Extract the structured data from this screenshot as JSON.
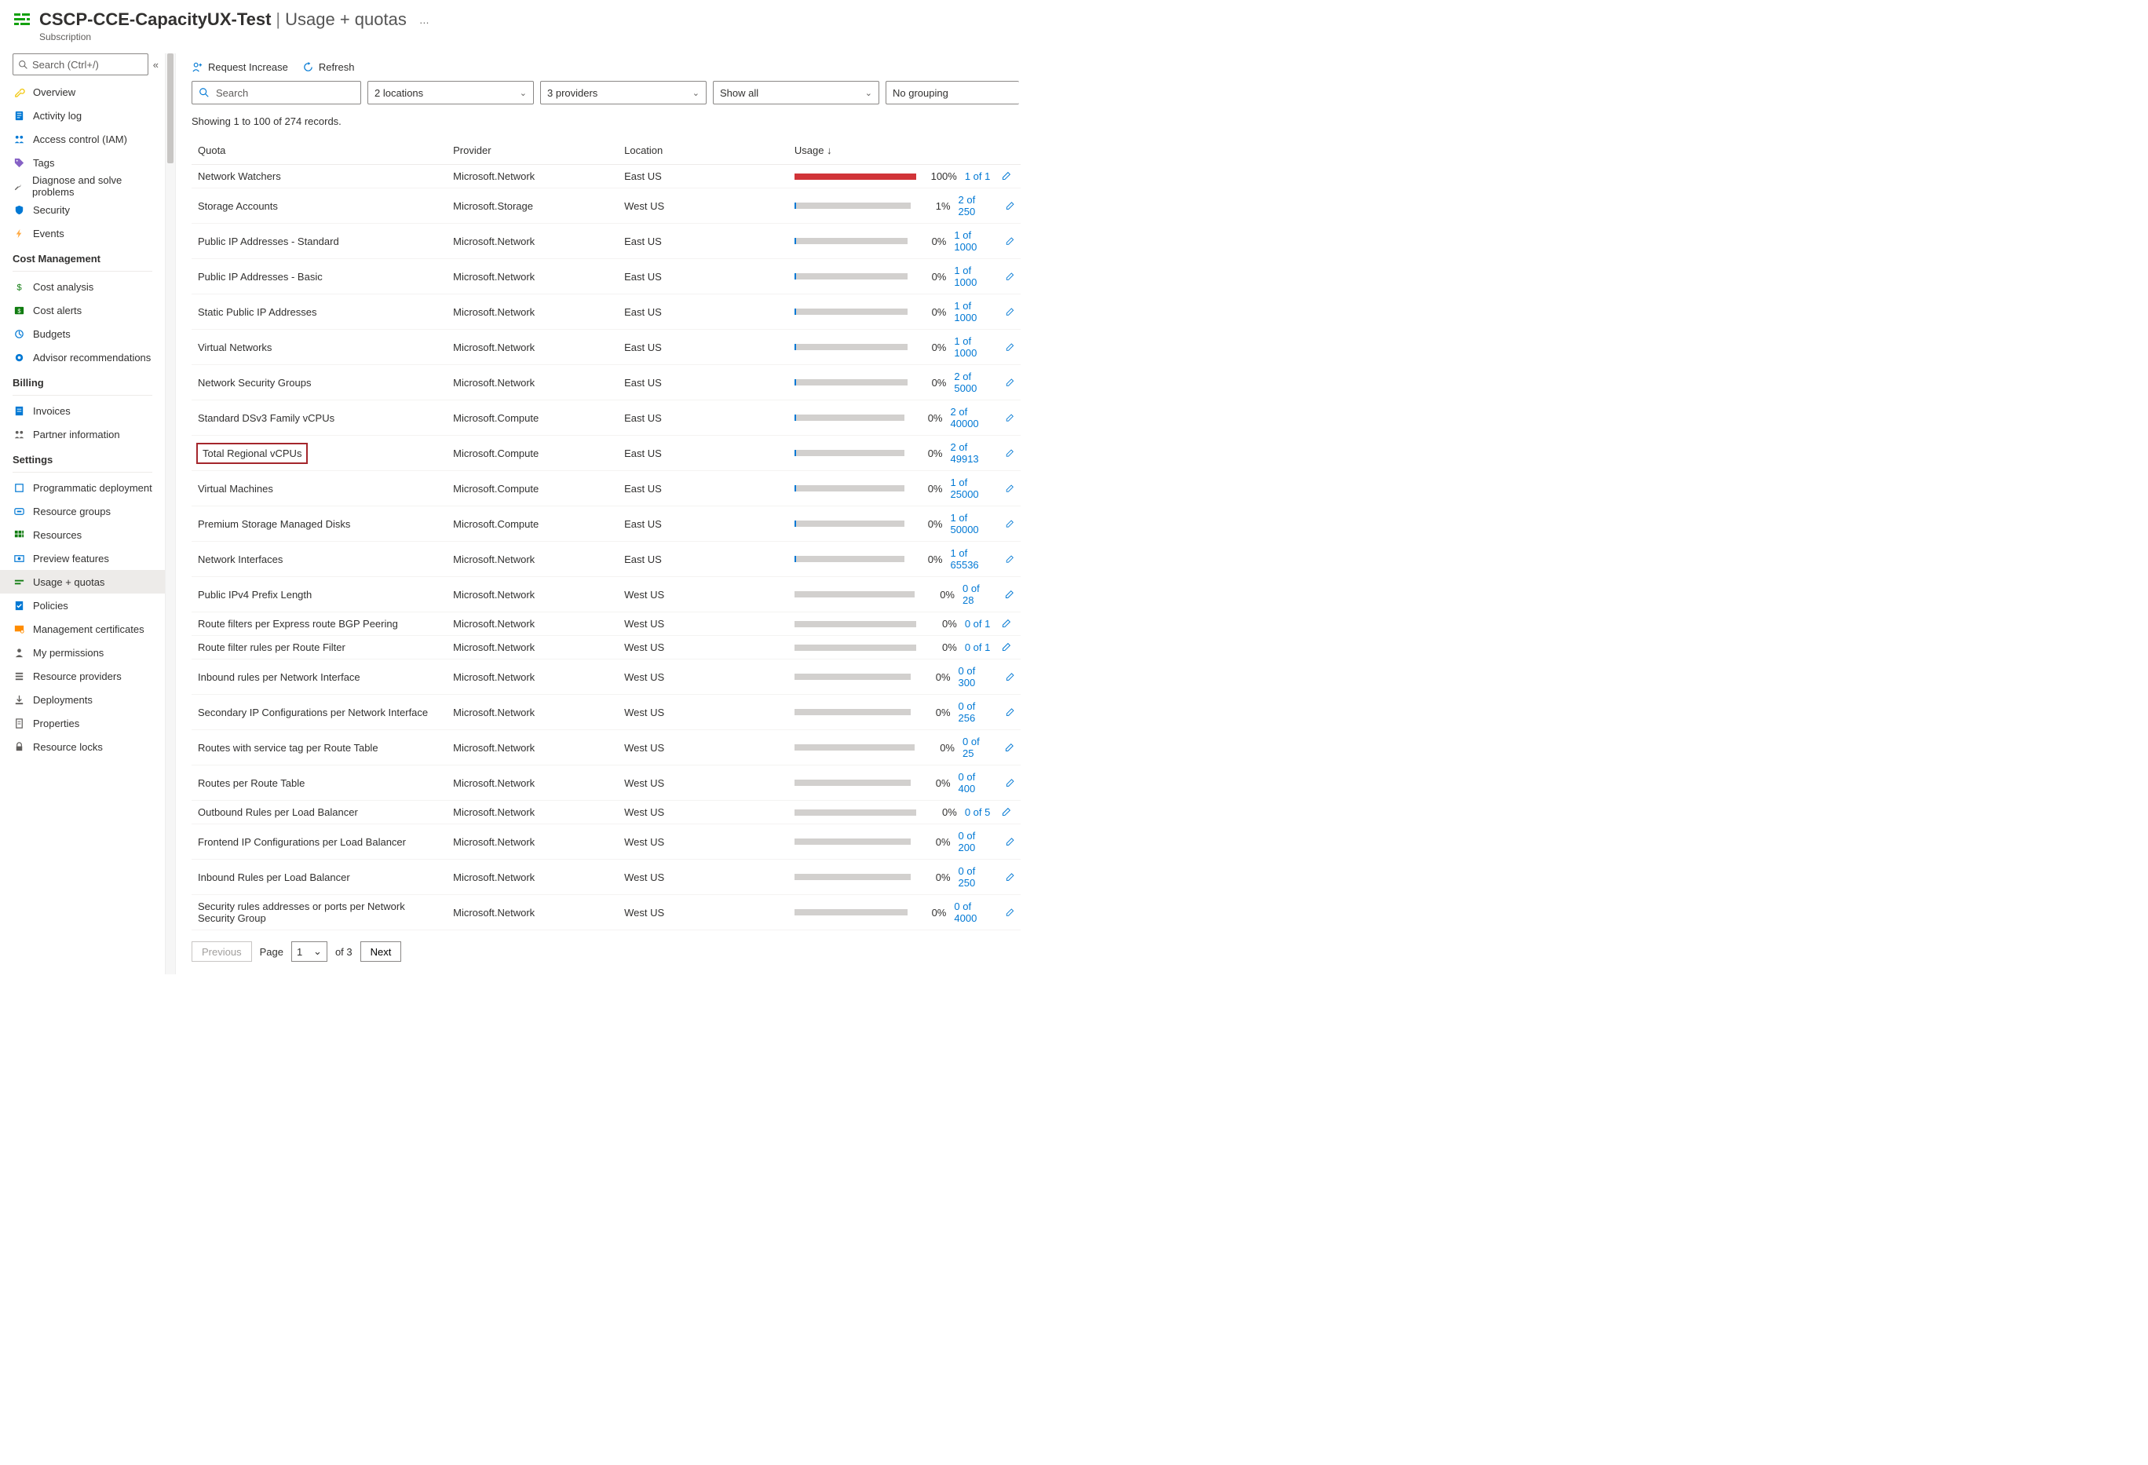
{
  "header": {
    "title": "CSCP-CCE-CapacityUX-Test",
    "page": "Usage + quotas",
    "subtitle": "Subscription",
    "more": "…"
  },
  "sidebar": {
    "search_placeholder": "Search (Ctrl+/)",
    "collapse_glyph": "«",
    "top_items": [
      {
        "label": "Overview",
        "icon": "key",
        "color": "#f2c811"
      },
      {
        "label": "Activity log",
        "icon": "log",
        "color": "#0078d4"
      },
      {
        "label": "Access control (IAM)",
        "icon": "people",
        "color": "#0078d4"
      },
      {
        "label": "Tags",
        "icon": "tag",
        "color": "#8661c5"
      },
      {
        "label": "Diagnose and solve problems",
        "icon": "wrench",
        "color": "#605e5c"
      },
      {
        "label": "Security",
        "icon": "shield",
        "color": "#0078d4"
      },
      {
        "label": "Events",
        "icon": "bolt",
        "color": "#ffaa44"
      }
    ],
    "sections": [
      {
        "title": "Cost Management",
        "items": [
          {
            "label": "Cost analysis",
            "icon": "dollar",
            "color": "#107c10"
          },
          {
            "label": "Cost alerts",
            "icon": "dollarbox",
            "color": "#107c10"
          },
          {
            "label": "Budgets",
            "icon": "budget",
            "color": "#0078d4"
          },
          {
            "label": "Advisor recommendations",
            "icon": "advisor",
            "color": "#0078d4"
          }
        ]
      },
      {
        "title": "Billing",
        "items": [
          {
            "label": "Invoices",
            "icon": "invoice",
            "color": "#0078d4"
          },
          {
            "label": "Partner information",
            "icon": "people",
            "color": "#605e5c"
          }
        ]
      },
      {
        "title": "Settings",
        "items": [
          {
            "label": "Programmatic deployment",
            "icon": "box",
            "color": "#0078d4"
          },
          {
            "label": "Resource groups",
            "icon": "rg",
            "color": "#0078d4"
          },
          {
            "label": "Resources",
            "icon": "grid",
            "color": "#107c10"
          },
          {
            "label": "Preview features",
            "icon": "preview",
            "color": "#0078d4"
          },
          {
            "label": "Usage + quotas",
            "icon": "quota",
            "color": "#107c10",
            "selected": true
          },
          {
            "label": "Policies",
            "icon": "policy",
            "color": "#0078d4"
          },
          {
            "label": "Management certificates",
            "icon": "cert",
            "color": "#ff8c00"
          },
          {
            "label": "My permissions",
            "icon": "person",
            "color": "#605e5c"
          },
          {
            "label": "Resource providers",
            "icon": "stack",
            "color": "#605e5c"
          },
          {
            "label": "Deployments",
            "icon": "deploy",
            "color": "#605e5c"
          },
          {
            "label": "Properties",
            "icon": "props",
            "color": "#605e5c"
          },
          {
            "label": "Resource locks",
            "icon": "lock",
            "color": "#605e5c"
          }
        ]
      }
    ]
  },
  "toolbar": {
    "request_increase": "Request Increase",
    "refresh": "Refresh"
  },
  "filters": {
    "search_placeholder": "Search",
    "locations": "2 locations",
    "providers": "3 providers",
    "usage": "Show all",
    "grouping": "No grouping"
  },
  "result_count": "Showing 1 to 100 of 274 records.",
  "table": {
    "headers": {
      "quota": "Quota",
      "provider": "Provider",
      "location": "Location",
      "usage": "Usage ↓"
    },
    "rows": [
      {
        "quota": "Network Watchers",
        "provider": "Microsoft.Network",
        "location": "East US",
        "pct": "100%",
        "link": "1 of 1",
        "bar": "full"
      },
      {
        "quota": "Storage Accounts",
        "provider": "Microsoft.Storage",
        "location": "West US",
        "pct": "1%",
        "link": "2 of 250",
        "bar": "tick"
      },
      {
        "quota": "Public IP Addresses - Standard",
        "provider": "Microsoft.Network",
        "location": "East US",
        "pct": "0%",
        "link": "1 of 1000",
        "bar": "tick"
      },
      {
        "quota": "Public IP Addresses - Basic",
        "provider": "Microsoft.Network",
        "location": "East US",
        "pct": "0%",
        "link": "1 of 1000",
        "bar": "tick"
      },
      {
        "quota": "Static Public IP Addresses",
        "provider": "Microsoft.Network",
        "location": "East US",
        "pct": "0%",
        "link": "1 of 1000",
        "bar": "tick"
      },
      {
        "quota": "Virtual Networks",
        "provider": "Microsoft.Network",
        "location": "East US",
        "pct": "0%",
        "link": "1 of 1000",
        "bar": "tick"
      },
      {
        "quota": "Network Security Groups",
        "provider": "Microsoft.Network",
        "location": "East US",
        "pct": "0%",
        "link": "2 of 5000",
        "bar": "tick"
      },
      {
        "quota": "Standard DSv3 Family vCPUs",
        "provider": "Microsoft.Compute",
        "location": "East US",
        "pct": "0%",
        "link": "2 of 40000",
        "bar": "tick"
      },
      {
        "quota": "Total Regional vCPUs",
        "provider": "Microsoft.Compute",
        "location": "East US",
        "pct": "0%",
        "link": "2 of 49913",
        "bar": "tick",
        "highlight": true
      },
      {
        "quota": "Virtual Machines",
        "provider": "Microsoft.Compute",
        "location": "East US",
        "pct": "0%",
        "link": "1 of 25000",
        "bar": "tick"
      },
      {
        "quota": "Premium Storage Managed Disks",
        "provider": "Microsoft.Compute",
        "location": "East US",
        "pct": "0%",
        "link": "1 of 50000",
        "bar": "tick"
      },
      {
        "quota": "Network Interfaces",
        "provider": "Microsoft.Network",
        "location": "East US",
        "pct": "0%",
        "link": "1 of 65536",
        "bar": "tick"
      },
      {
        "quota": "Public IPv4 Prefix Length",
        "provider": "Microsoft.Network",
        "location": "West US",
        "pct": "0%",
        "link": "0 of 28",
        "bar": "none"
      },
      {
        "quota": "Route filters per Express route BGP Peering",
        "provider": "Microsoft.Network",
        "location": "West US",
        "pct": "0%",
        "link": "0 of 1",
        "bar": "none"
      },
      {
        "quota": "Route filter rules per Route Filter",
        "provider": "Microsoft.Network",
        "location": "West US",
        "pct": "0%",
        "link": "0 of 1",
        "bar": "none"
      },
      {
        "quota": "Inbound rules per Network Interface",
        "provider": "Microsoft.Network",
        "location": "West US",
        "pct": "0%",
        "link": "0 of 300",
        "bar": "none"
      },
      {
        "quota": "Secondary IP Configurations per Network Interface",
        "provider": "Microsoft.Network",
        "location": "West US",
        "pct": "0%",
        "link": "0 of 256",
        "bar": "none"
      },
      {
        "quota": "Routes with service tag per Route Table",
        "provider": "Microsoft.Network",
        "location": "West US",
        "pct": "0%",
        "link": "0 of 25",
        "bar": "none"
      },
      {
        "quota": "Routes per Route Table",
        "provider": "Microsoft.Network",
        "location": "West US",
        "pct": "0%",
        "link": "0 of 400",
        "bar": "none"
      },
      {
        "quota": "Outbound Rules per Load Balancer",
        "provider": "Microsoft.Network",
        "location": "West US",
        "pct": "0%",
        "link": "0 of 5",
        "bar": "none"
      },
      {
        "quota": "Frontend IP Configurations per Load Balancer",
        "provider": "Microsoft.Network",
        "location": "West US",
        "pct": "0%",
        "link": "0 of 200",
        "bar": "none"
      },
      {
        "quota": "Inbound Rules per Load Balancer",
        "provider": "Microsoft.Network",
        "location": "West US",
        "pct": "0%",
        "link": "0 of 250",
        "bar": "none"
      },
      {
        "quota": "Security rules addresses or ports per Network Security Group",
        "provider": "Microsoft.Network",
        "location": "West US",
        "pct": "0%",
        "link": "0 of 4000",
        "bar": "none"
      }
    ]
  },
  "pager": {
    "previous": "Previous",
    "page_label": "Page",
    "page": "1",
    "of_label": "of 3",
    "next": "Next"
  }
}
